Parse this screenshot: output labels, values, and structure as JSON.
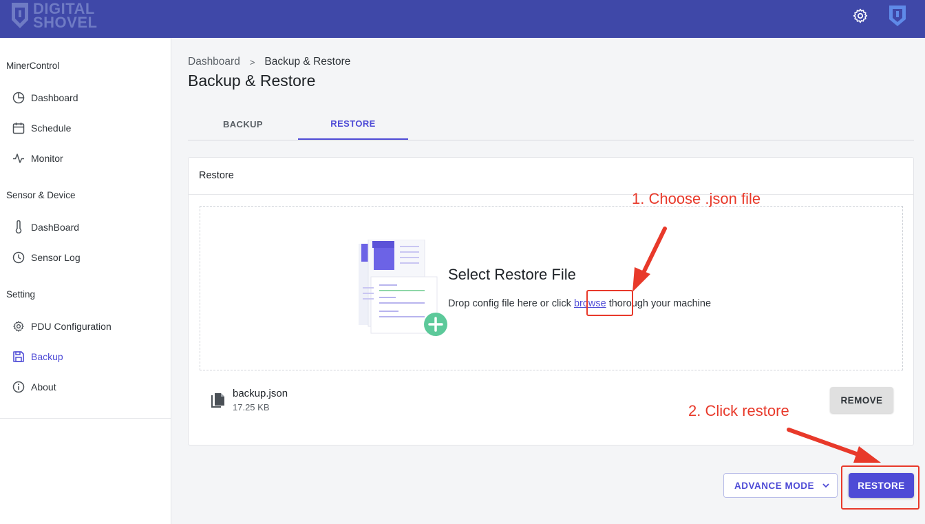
{
  "app": {
    "logo_text_line1": "DIGITAL",
    "logo_text_line2": "SHOVEL",
    "brand_color": "#3f48a8",
    "accent_color": "#4e4bd6"
  },
  "topbar": {
    "settings_icon": "gear-icon",
    "account_icon": "shield-logo-icon"
  },
  "sidebar": {
    "sections": [
      {
        "title": "MinerControl",
        "items": [
          {
            "label": "Dashboard",
            "icon": "pie-chart-icon",
            "active": false
          },
          {
            "label": "Schedule",
            "icon": "calendar-icon",
            "active": false
          },
          {
            "label": "Monitor",
            "icon": "pulse-icon",
            "active": false
          }
        ]
      },
      {
        "title": "Sensor & Device",
        "items": [
          {
            "label": "DashBoard",
            "icon": "thermometer-icon",
            "active": false
          },
          {
            "label": "Sensor Log",
            "icon": "clock-icon",
            "active": false
          }
        ]
      },
      {
        "title": "Setting",
        "items": [
          {
            "label": "PDU Configuration",
            "icon": "gear-icon",
            "active": false
          },
          {
            "label": "Backup",
            "icon": "floppy-disk-icon",
            "active": true
          },
          {
            "label": "About",
            "icon": "info-icon",
            "active": false
          }
        ]
      }
    ]
  },
  "breadcrumb": {
    "items": [
      "Dashboard",
      "Backup & Restore"
    ],
    "separator": ">"
  },
  "page": {
    "title": "Backup & Restore"
  },
  "tabs": [
    {
      "label": "BACKUP",
      "active": false
    },
    {
      "label": "RESTORE",
      "active": true
    }
  ],
  "restore_card": {
    "title": "Restore",
    "dropzone": {
      "heading": "Select Restore File",
      "desc_before": "Drop config file here or click ",
      "browse_link": "browse",
      "desc_after": " thorough your machine"
    },
    "file": {
      "name": "backup.json",
      "size": "17.25 KB"
    },
    "remove_label": "REMOVE"
  },
  "actions": {
    "advance_mode_label": "ADVANCE MODE",
    "restore_label": "RESTORE"
  },
  "annotations": {
    "step1": "1. Choose .json file",
    "step2": "2. Click restore",
    "color": "#e8392a"
  }
}
